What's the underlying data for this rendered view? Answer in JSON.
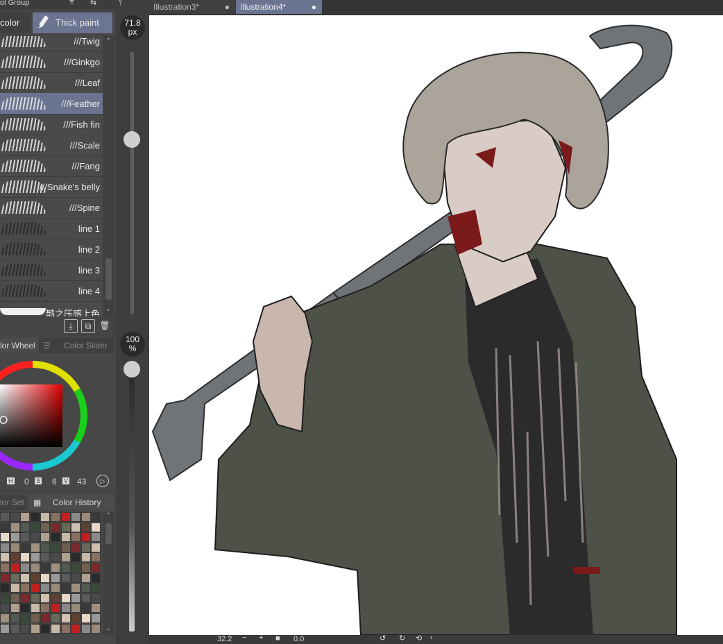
{
  "left_panel": {
    "top_strip_label": "ol Group",
    "brush_tabs": {
      "left_label": "color",
      "right_label": "Thick paint"
    },
    "brushes": [
      {
        "name": "///Twig"
      },
      {
        "name": "///Ginkgo"
      },
      {
        "name": "///Leaf"
      },
      {
        "name": "///Feather",
        "selected": true
      },
      {
        "name": "///Fish fin"
      },
      {
        "name": "///Scale"
      },
      {
        "name": "///Fang"
      },
      {
        "name": "///Snake's belly"
      },
      {
        "name": "///Spine"
      },
      {
        "name": "line 1"
      },
      {
        "name": "line 2"
      },
      {
        "name": "line 3"
      },
      {
        "name": "line 4"
      },
      {
        "name": "鹊之压感上色"
      }
    ],
    "color_tabs": {
      "wheel": "lor Wheel",
      "slider": "Color Slider"
    },
    "hsv": {
      "h_label": "H",
      "h": "0",
      "s_label": "S",
      "s": "6",
      "v_label": "V",
      "v": "43"
    },
    "history_tabs": {
      "set": "lor Set",
      "history": "Color History"
    }
  },
  "sliders": {
    "size": "71.8",
    "size_unit": "px",
    "opacity": "100",
    "opacity_unit": "%"
  },
  "tabs": [
    {
      "label": "Illustration3*",
      "active": false
    },
    {
      "label": "Illustration4*",
      "active": true
    }
  ],
  "status": {
    "zoom": "32.2",
    "angle": "0.0"
  },
  "colors": {
    "accent": "#6b7490",
    "coat": "#4d5148",
    "hair": "#aaa49b",
    "skin": "#d9ccc7",
    "blood": "#7a1a1a",
    "crowbar": "#6f7479"
  }
}
